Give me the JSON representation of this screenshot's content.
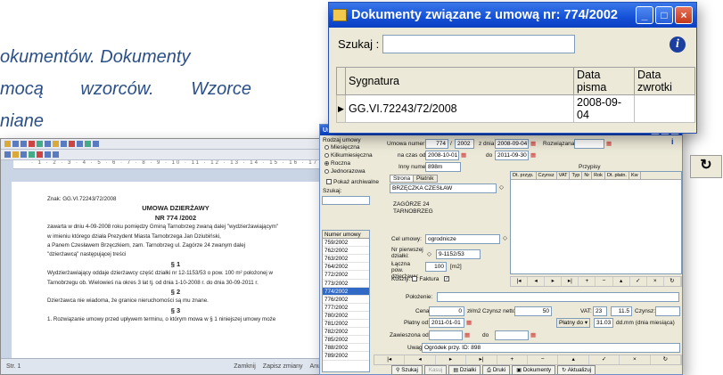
{
  "background_text": {
    "line1": "okumentów. Dokumenty",
    "line2a": "mocą",
    "line2b": "wzorców.",
    "line2c": "Wzorce",
    "line3": "niane"
  },
  "dialog": {
    "title": "Dokumenty związane z umową nr: 774/2002",
    "search_label": "Szukaj :",
    "search_value": "",
    "columns": [
      "Sygnatura",
      "Data pisma",
      "Data zwrotki"
    ],
    "rows": [
      [
        "GG.VI.72243/72/2008",
        "2008-09-04",
        ""
      ]
    ],
    "info_label": "i"
  },
  "document": {
    "ruler": "· 1 · 2 · 3 · 4 · 5 · 6 · 7 · 8 · 9 · 10 · 11 · 12 · 13 · 14 · 15 · 16 · 17 · 18",
    "znak": "Znak: GG.VI.72243/72/2008",
    "heading1": "UMOWA DZIERŻAWY",
    "heading2": "NR 774 /2002",
    "p1": "zawarta w dniu 4-09-2008 roku pomiędzy Gminą Tarnobrzeg zwaną dalej \"wydzierżawiającym\"",
    "p1b": "w imieniu którego działa Prezydent Miasta Tarnobrzega Jan Dziubiński,",
    "p1c": "a Panem Czesławem Brzęczkiem, zam. Tarnobrzeg ul. Zagórze 24 zwanym dalej",
    "p1d": "\"dzierżawcą\" następującej treści",
    "s1": "§ 1",
    "p2": "Wydzierżawiający oddaje dzierżawcy część działki nr 12-1153/53 o pow. 100 m² położonej w",
    "p2b": "Tarnobrzegu ob. Wielowieś na okres 3 lat tj. od dnia 1-10-2008 r. do dnia 30-09-2011 r.",
    "s2": "§ 2",
    "p3": "Dzierżawca nie wiadoma, że granice nieruchomości są mu znane.",
    "s3": "§ 3",
    "p4": "1. Rozwiązanie umowy przed upływem terminu, o którym mowa w § 1 niniejszej umowy może",
    "status1": "Str. 1",
    "status2": "Zamknij",
    "status3": "Zapisz zmiany",
    "status4": "Anuluj"
  },
  "umowy": {
    "title": "Umowy",
    "rodzaj_label": "Rodzaj umowy",
    "radio1": "Miesięczna",
    "radio2": "Kilkumiesięczna",
    "radio3": "Roczna",
    "radio4": "Jednorazowa",
    "archiwalne": "Pokaż archiwalne",
    "szukaj": "Szukaj:",
    "list_header": "Numer umowy",
    "list": [
      "759/2002",
      "762/2002",
      "763/2002",
      "764/2002",
      "772/2002",
      "773/2002",
      "774/2002",
      "776/2002",
      "777/2002",
      "780/2002",
      "781/2002",
      "782/2002",
      "785/2002",
      "788/2002",
      "789/2002"
    ],
    "selected": "774/2002",
    "numer_label": "Umowa numer:",
    "numer_val": "774",
    "rok_val": "2002",
    "z_dnia_label": "z dnia",
    "z_dnia_val": "2008-09-04",
    "rozwiazana_label": "Rozwiązana",
    "na_czas_label": "na czas od:",
    "od_val": "2008-10-01",
    "do_label": "do",
    "do_val": "2011-09-30",
    "inny_label": "Inny numer:",
    "inny_val": "898m",
    "tab1": "Strona",
    "tab2": "Płatnik",
    "strona_name": "BRZĘCZKA CZESŁAW",
    "strona_addr1": "ZAGÓRZE 24",
    "strona_addr2": "TARNOBRZEG",
    "przypisy": "Przypisy",
    "grid_cols": [
      "Dt. przyp.",
      "Czynsz",
      "VAT",
      "Typ",
      "Nr",
      "Rok",
      "Dt. płatn.",
      "Kw"
    ],
    "cel_label": "Cel umowy:",
    "cel_val": "ogrodnicze",
    "nr_dzialki_label": "Nr pierwszej działki:",
    "nr_dzialki_val": "9-1152/53",
    "pow_label": "Łączna pow. dzierżawy:",
    "pow_val": "100",
    "pow_unit": "[m2]",
    "koszty_label": "Koszty:",
    "faktura": "Faktura",
    "polozenie_label": "Położenie:",
    "cena_label": "Cena:",
    "cena_val": "0",
    "cena_unit": "zł/m2",
    "czynsz_netto_label": "Czynsz netto:",
    "czynsz_netto_val": "50",
    "vat_label": "VAT:",
    "vat_val": "23",
    "vat_val2": "11.5",
    "czynsz_label": "Czynsz:",
    "platny_label": "Płatny od:",
    "platny_val": "2011-01-01",
    "platny_do_label": "Płatny do",
    "platny_do_val": "31.03",
    "platny_hint": "dd.mm (dnia miesiąca)",
    "zawieszona_label": "Zawieszona od:",
    "uwagi_label": "Uwagi:",
    "uwagi_val": "Ogródek przy. ID: 898",
    "btn_szukaj": "Szukaj",
    "btn_kasuj": "Kasuj",
    "btn_dzialki": "Działki",
    "btn_druki": "Druki",
    "btn_dokumenty": "Dokumenty",
    "btn_aktualizuj": "Aktualizuj"
  }
}
